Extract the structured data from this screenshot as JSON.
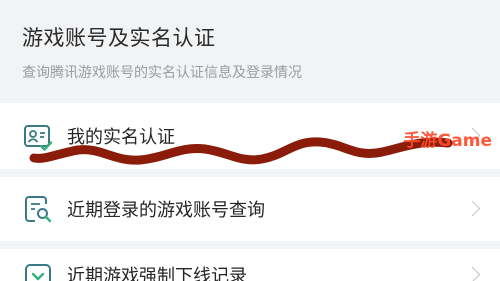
{
  "section": {
    "title": "游戏账号及实名认证",
    "subtitle": "查询腾讯游戏账号的实名认证信息及登录情况"
  },
  "items": [
    {
      "label": "我的实名认证",
      "icon": "id-card-check-icon"
    },
    {
      "label": "近期登录的游戏账号查询",
      "icon": "document-search-icon"
    },
    {
      "label": "近期游戏强制下线记录",
      "icon": "download-record-icon"
    }
  ],
  "watermark": {
    "text": "手游Game"
  },
  "colors": {
    "icon_accent": "#3a7a86",
    "icon_check": "#35b07a",
    "scribble": "#8b1c0a",
    "watermark": "#ff4a2a"
  }
}
